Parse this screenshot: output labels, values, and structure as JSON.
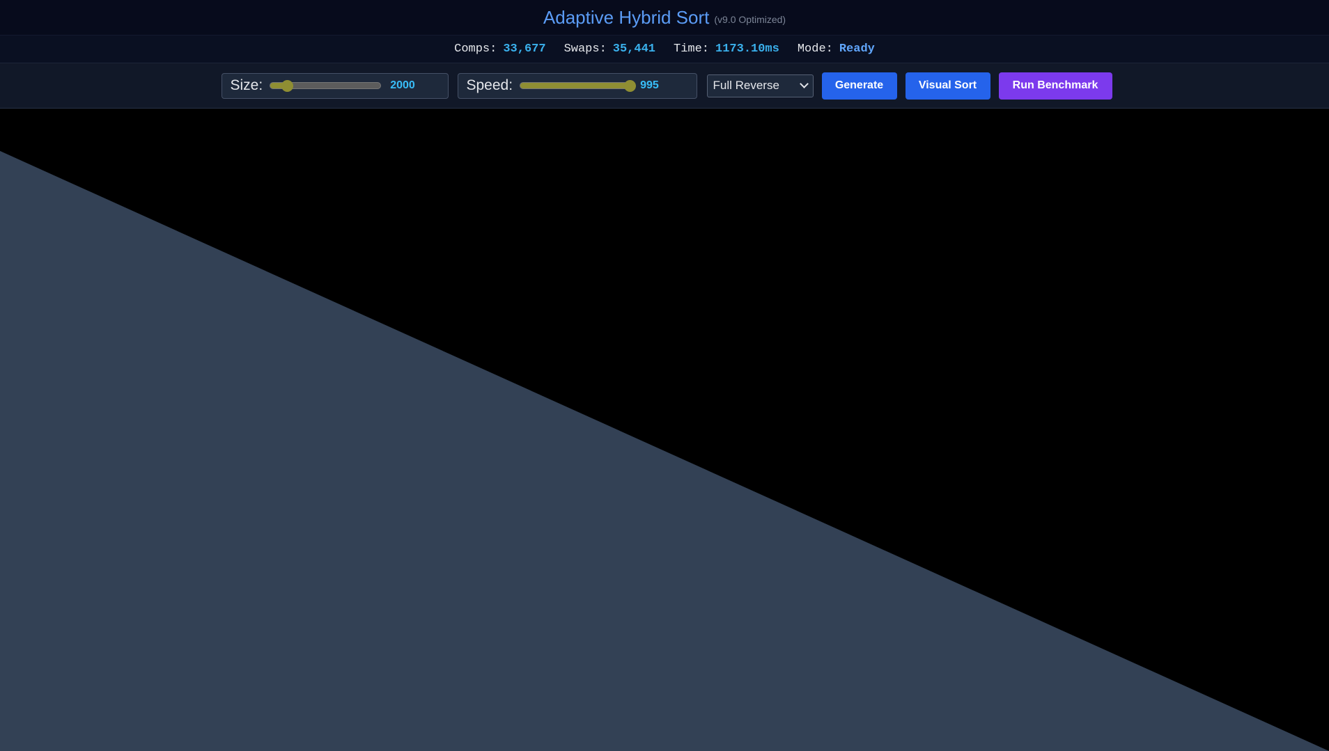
{
  "header": {
    "title": "Adaptive Hybrid Sort",
    "version": "(v9.0 Optimized)"
  },
  "stats": {
    "comps_label": "Comps:",
    "comps_value": "33,677",
    "swaps_label": "Swaps:",
    "swaps_value": "35,441",
    "time_label": "Time:",
    "time_value": "1173.10ms",
    "mode_label": "Mode:",
    "mode_value": "Ready"
  },
  "controls": {
    "size": {
      "label": "Size:",
      "value": "2000",
      "fraction": 0.15
    },
    "speed": {
      "label": "Speed:",
      "value": "995",
      "fraction": 0.995
    },
    "pattern_select": {
      "selected": "Full Reverse"
    },
    "generate_label": "Generate",
    "visual_sort_label": "Visual Sort",
    "benchmark_label": "Run Benchmark"
  },
  "visualization": {
    "bar_color": "#334155",
    "background_color": "#000000",
    "first_bar_height_fraction": 0.935,
    "last_bar_height_fraction": 0.0
  },
  "colors": {
    "accent_blue": "#2563eb",
    "accent_purple": "#7c3aed",
    "stat_value": "#3ab0ec",
    "slider": "#8f8e33"
  }
}
